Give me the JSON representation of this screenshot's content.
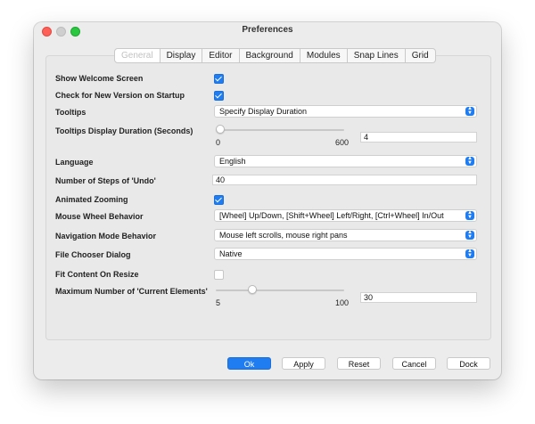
{
  "window": {
    "title": "Preferences"
  },
  "tabs": [
    {
      "label": "General",
      "active": true
    },
    {
      "label": "Display"
    },
    {
      "label": "Editor"
    },
    {
      "label": "Background"
    },
    {
      "label": "Modules"
    },
    {
      "label": "Snap Lines"
    },
    {
      "label": "Grid"
    }
  ],
  "prefs": {
    "welcome_label": "Show Welcome Screen",
    "welcome_checked": true,
    "check_version_label": "Check for New Version on Startup",
    "check_version_checked": true,
    "tooltips_label": "Tooltips",
    "tooltips_value": "Specify Display Duration",
    "tooltip_duration_label": "Tooltips Display Duration (Seconds)",
    "tooltip_duration_min": "0",
    "tooltip_duration_max": "600",
    "tooltip_duration_value": "4",
    "language_label": "Language",
    "language_value": "English",
    "undo_label": "Number of Steps of 'Undo'",
    "undo_value": "40",
    "animated_zoom_label": "Animated Zooming",
    "animated_zoom_checked": true,
    "mouse_wheel_label": "Mouse Wheel Behavior",
    "mouse_wheel_value": "[Wheel] Up/Down, [Shift+Wheel] Left/Right, [Ctrl+Wheel] In/Out",
    "nav_mode_label": "Navigation Mode Behavior",
    "nav_mode_value": "Mouse left scrolls, mouse right pans",
    "file_chooser_label": "File Chooser Dialog",
    "file_chooser_value": "Native",
    "fit_content_label": "Fit Content On Resize",
    "fit_content_checked": false,
    "max_elements_label": "Maximum Number of 'Current Elements'",
    "max_elements_min": "5",
    "max_elements_max": "100",
    "max_elements_value": "30"
  },
  "buttons": {
    "ok": "Ok",
    "apply": "Apply",
    "reset": "Reset",
    "cancel": "Cancel",
    "dock": "Dock"
  },
  "colors": {
    "accent": "#1f7cf1",
    "close": "#fe5f57",
    "maximize": "#29c840"
  }
}
